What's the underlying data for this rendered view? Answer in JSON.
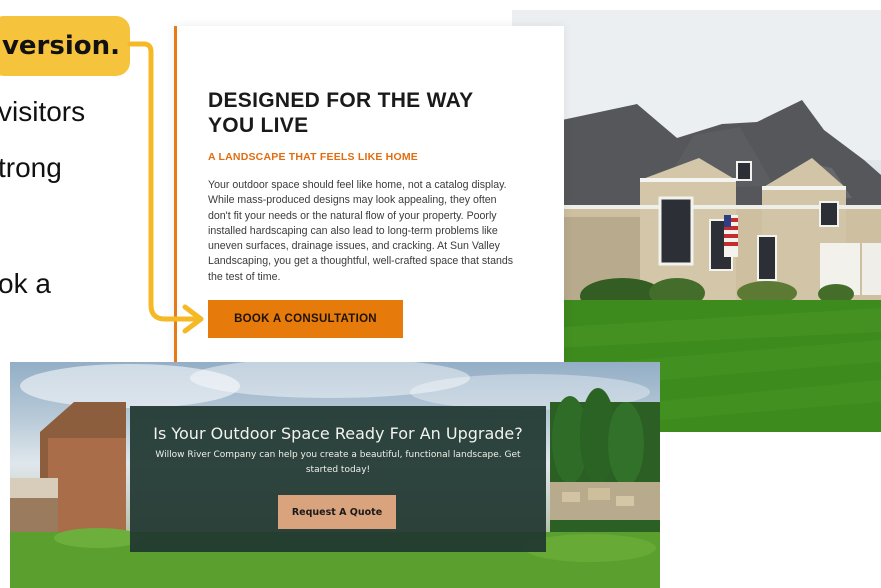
{
  "left_text": {
    "callout": "version.",
    "line1": "visitors",
    "line2": "trong",
    "line3": "ok a"
  },
  "card": {
    "title": "DESIGNED FOR THE WAY YOU LIVE",
    "subtitle": "A LANDSCAPE THAT FEELS LIKE HOME",
    "body": "Your outdoor space should feel like home, not a catalog display. While mass-produced designs may look appealing, they often don't fit your needs or the natural flow of your property. Poorly installed hardscaping can also lead to long-term problems like uneven surfaces, drainage issues, and cracking. At Sun Valley Landscaping, you get a thoughtful, well-crafted space that stands the test of time.",
    "button_label": "BOOK A CONSULTATION"
  },
  "bottom_panel": {
    "title": "Is Your Outdoor Space Ready For An Upgrade?",
    "text": "Willow River Company can help you create a beautiful, functional landscape. Get started today!",
    "button_label": "Request A Quote"
  },
  "colors": {
    "callout_yellow": "#f6c33c",
    "accent_orange": "#e67a0a",
    "panel_green": "#203730",
    "quote_button": "#d8a37d"
  }
}
